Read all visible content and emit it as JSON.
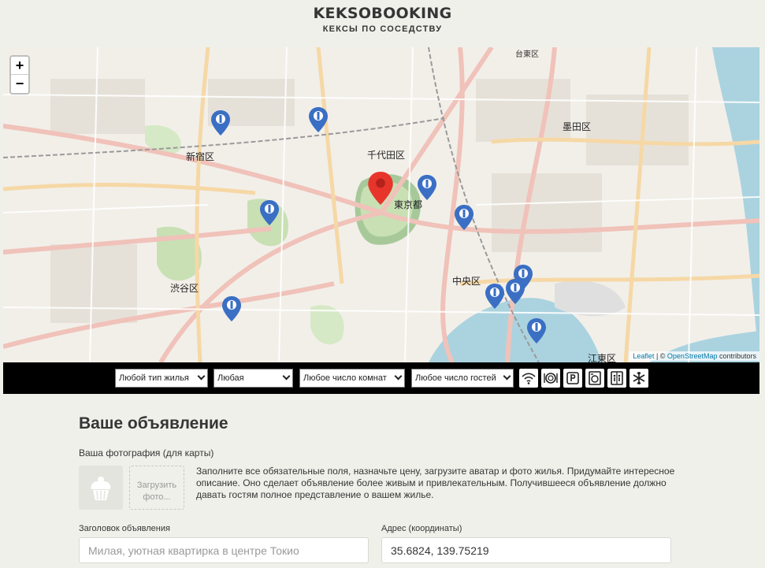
{
  "header": {
    "logo": "KEKSOBOOKING",
    "tagline": "КЕКСЫ ПО СОСЕДСТВУ"
  },
  "map": {
    "zoom_in": "+",
    "zoom_out": "−",
    "labels": [
      "新宿区",
      "千代田区",
      "東京都",
      "墨田区",
      "中央区",
      "渋谷区",
      "江東区",
      "台東区"
    ],
    "attribution": {
      "leaflet": "Leaflet",
      "separator": " | © ",
      "osm": "OpenStreetMap",
      "suffix": " contributors"
    }
  },
  "filters": {
    "housing_type": "Любой тип жилья",
    "price": "Любая",
    "rooms": "Любое число комнат",
    "guests": "Любое число гостей",
    "features": [
      "wifi-icon",
      "dishwasher-icon",
      "parking-icon",
      "washer-icon",
      "elevator-icon",
      "conditioner-icon"
    ]
  },
  "form": {
    "title": "Ваше объявление",
    "photo_label": "Ваша фотография (для карты)",
    "upload_label": "Загрузить фото...",
    "hint": "Заполните все обязательные поля, назначьте цену, загрузите аватар и фото жилья. Придумайте интересное описание. Оно сделает объявление более живым и привлекательным. Получившееся объявление должно давать гостям полное представление о вашем жилье.",
    "title_label": "Заголовок объявления",
    "title_placeholder": "Милая, уютная квартирка в центре Токио",
    "address_label": "Адрес (координаты)",
    "address_value": "35.6824, 139.75219"
  },
  "colors": {
    "main_pin": "#e8352b",
    "pin": "#3a6fc4",
    "filter_bar": "#000000"
  }
}
